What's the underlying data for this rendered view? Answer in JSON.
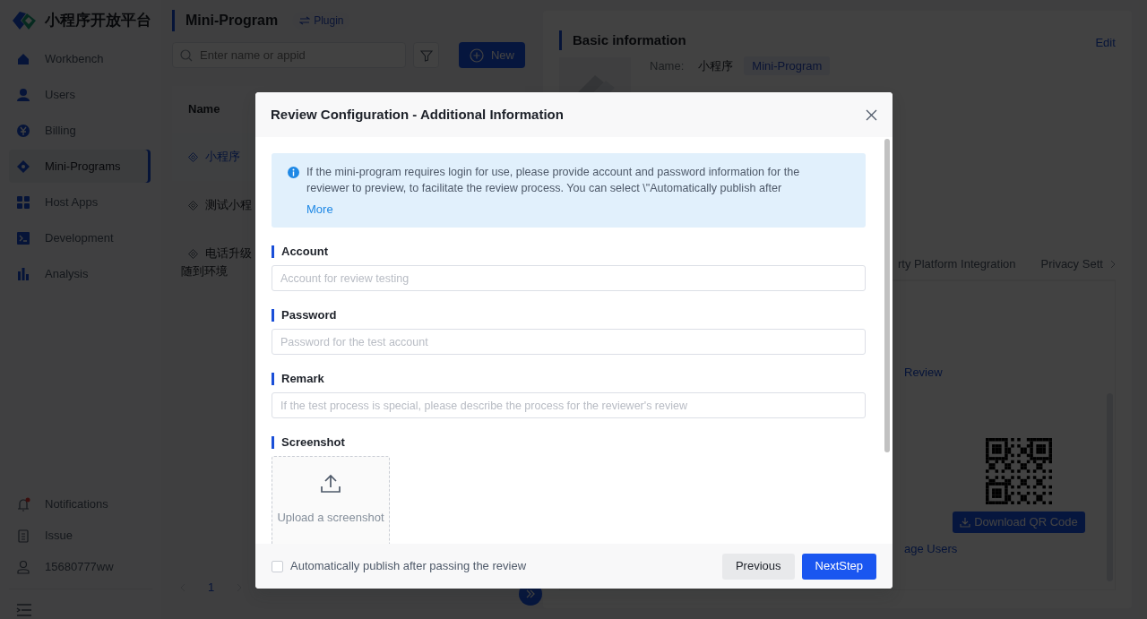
{
  "brand": {
    "name": "小程序开放平台"
  },
  "sidebar": {
    "items": [
      {
        "label": "Workbench",
        "selected": false
      },
      {
        "label": "Users",
        "selected": false
      },
      {
        "label": "Billing",
        "selected": false
      },
      {
        "label": "Mini-Programs",
        "selected": true
      },
      {
        "label": "Host Apps",
        "selected": false
      },
      {
        "label": "Development",
        "selected": false
      },
      {
        "label": "Analysis",
        "selected": false
      }
    ],
    "bottom": [
      {
        "label": "Notifications",
        "unread": true
      },
      {
        "label": "Issue",
        "unread": false
      },
      {
        "label": "15680777ww",
        "unread": false
      }
    ]
  },
  "header": {
    "title": "Mini-Program",
    "badge": "Plugin",
    "badge_selected": false
  },
  "search": {
    "placeholder": "Enter name or appid"
  },
  "new_button": "New",
  "table": {
    "columns": [
      "Name"
    ],
    "rows": [
      {
        "lines": [
          "小程序"
        ],
        "selected": true
      },
      {
        "lines": [
          "测试小程"
        ],
        "selected": false
      },
      {
        "lines": [
          "电话升级",
          "随到环境"
        ],
        "selected": false
      }
    ]
  },
  "pagination": {
    "pages": [
      {
        "label": "1",
        "selected": true
      }
    ]
  },
  "details": {
    "title": "Basic information",
    "edit": "Edit",
    "name_label": "Name:",
    "name_value": "小程序",
    "tag": "Mini-Program",
    "tabs": [
      {
        "label": "rty Platform Integration",
        "selected": false
      },
      {
        "label": "Privacy Sett",
        "selected": false
      }
    ],
    "review_link": "Review",
    "qr_button": "Download QR Code",
    "users_link": "age Users"
  },
  "modal": {
    "title": "Review Configuration - Additional Information",
    "alert": {
      "text": "If the mini-program requires login for use, please provide account and password information for the reviewer to preview, to facilitate the review process. You can select \\\"Automatically publish after",
      "more": "More"
    },
    "fields": [
      {
        "label": "Account",
        "placeholder": "Account for review testing"
      },
      {
        "label": "Password",
        "placeholder": "Password for the test account"
      },
      {
        "label": "Remark",
        "placeholder": "If the test process is special, please describe the process for the reviewer's review"
      }
    ],
    "upload": {
      "label": "Screenshot",
      "text": "Upload a screenshot"
    },
    "auto_publish": {
      "label": "Automatically publish after passing the review",
      "checked": false
    },
    "buttons": [
      {
        "label": "Previous",
        "kind": "secondary"
      },
      {
        "label": "NextStep",
        "kind": "primary"
      }
    ]
  }
}
